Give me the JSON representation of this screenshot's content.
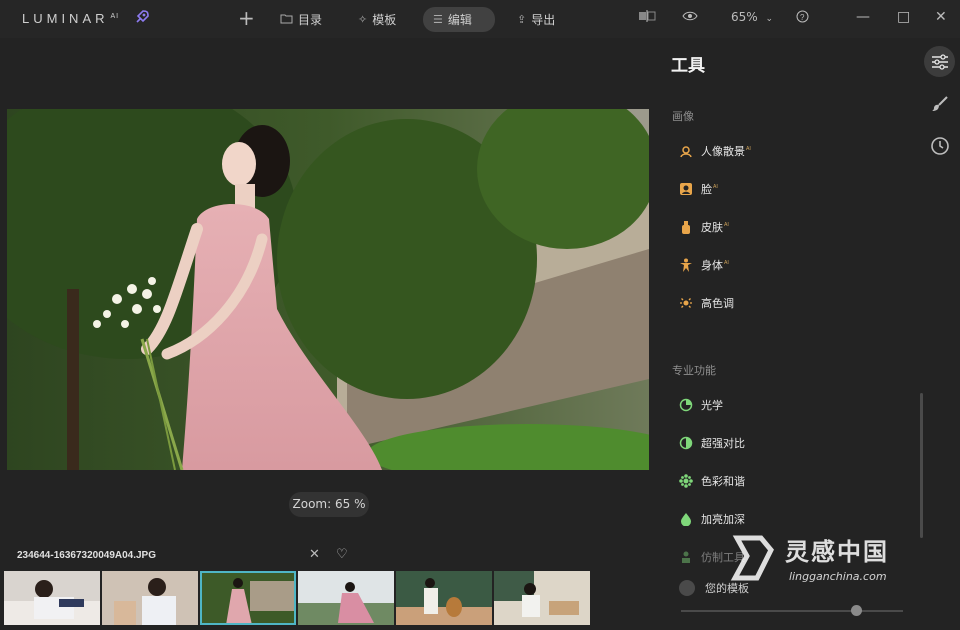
{
  "app": {
    "name": "LUMINAR",
    "superscript": "AI"
  },
  "topbar": {
    "catalog_label": "目录",
    "templates_label": "模板",
    "edit_label": "编辑",
    "export_label": "导出",
    "zoom_value": "65%"
  },
  "canvas": {
    "zoom_badge": "Zoom: 65 %"
  },
  "filmstrip": {
    "filename": "234644-16367320049A04.JPG",
    "selected_index": 2,
    "thumbnail_count": 6
  },
  "panel": {
    "title": "工具",
    "sections": [
      {
        "label": "画像",
        "tools": [
          {
            "label": "人像散景",
            "badge": "AI",
            "icon": "portrait-bokeh-icon",
            "color": "#e8a54a"
          },
          {
            "label": "脸",
            "badge": "AI",
            "icon": "face-icon",
            "color": "#e8a54a"
          },
          {
            "label": "皮肤",
            "badge": "AI",
            "icon": "skin-icon",
            "color": "#e8a54a"
          },
          {
            "label": "身体",
            "badge": "AI",
            "icon": "body-icon",
            "color": "#e8a54a"
          },
          {
            "label": "高色调",
            "badge": "",
            "icon": "high-key-icon",
            "color": "#e8a54a"
          }
        ]
      },
      {
        "label": "专业功能",
        "tools": [
          {
            "label": "光学",
            "badge": "",
            "icon": "optics-icon",
            "color": "#7fd77a"
          },
          {
            "label": "超强对比",
            "badge": "",
            "icon": "supercontrast-icon",
            "color": "#7fd77a"
          },
          {
            "label": "色彩和谐",
            "badge": "",
            "icon": "color-harmony-icon",
            "color": "#7fd77a"
          },
          {
            "label": "加亮加深",
            "badge": "",
            "icon": "dodge-burn-icon",
            "color": "#7fd77a"
          },
          {
            "label": "仿制工具",
            "badge": "",
            "icon": "clone-icon",
            "color": "#7fd77a"
          }
        ]
      }
    ],
    "my_templates_label": "您的模板"
  },
  "watermark": {
    "cn": "灵感中国",
    "en": "lingganchina.com"
  }
}
